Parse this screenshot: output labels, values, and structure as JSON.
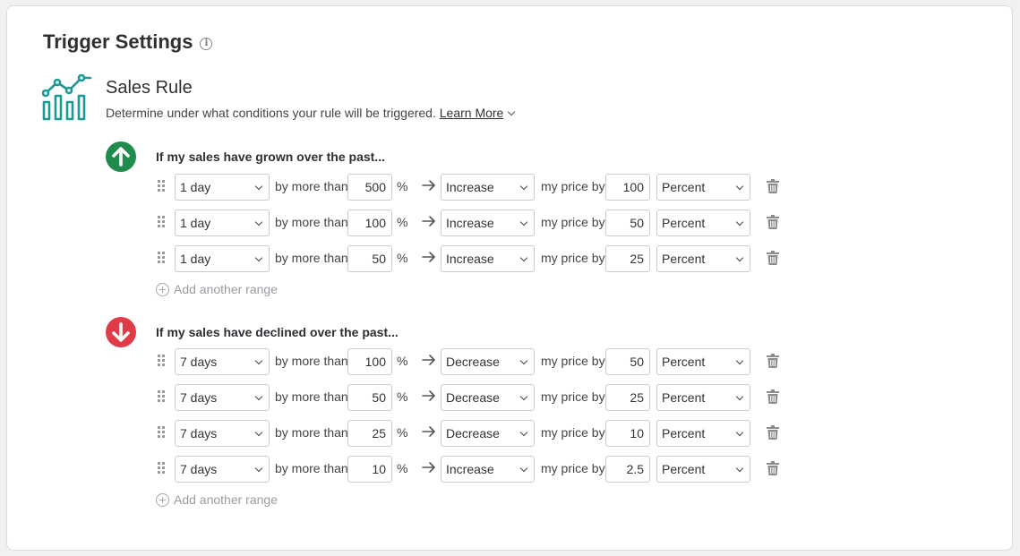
{
  "header": {
    "title": "Trigger Settings"
  },
  "rule": {
    "title": "Sales Rule",
    "description": "Determine under what conditions your rule will be triggered.",
    "learn_more": "Learn More",
    "icon": "chart-icon",
    "accent_color": "#1a9a94"
  },
  "grown": {
    "heading": "If my sales have grown over the past...",
    "icon": "arrow-up-icon",
    "color": "#1f8b4c",
    "add_label": "Add another range",
    "rows": [
      {
        "period": "1 day",
        "by_more_than": "by more than",
        "threshold": "500",
        "pct": "%",
        "action": "Increase",
        "my_price_by": "my price by",
        "amount": "100",
        "unit": "Percent"
      },
      {
        "period": "1 day",
        "by_more_than": "by more than",
        "threshold": "100",
        "pct": "%",
        "action": "Increase",
        "my_price_by": "my price by",
        "amount": "50",
        "unit": "Percent"
      },
      {
        "period": "1 day",
        "by_more_than": "by more than",
        "threshold": "50",
        "pct": "%",
        "action": "Increase",
        "my_price_by": "my price by",
        "amount": "25",
        "unit": "Percent"
      }
    ]
  },
  "declined": {
    "heading": "If my sales have declined over the past...",
    "icon": "arrow-down-icon",
    "color": "#e03b48",
    "add_label": "Add another range",
    "rows": [
      {
        "period": "7 days",
        "by_more_than": "by more than",
        "threshold": "100",
        "pct": "%",
        "action": "Decrease",
        "my_price_by": "my price by",
        "amount": "50",
        "unit": "Percent"
      },
      {
        "period": "7 days",
        "by_more_than": "by more than",
        "threshold": "50",
        "pct": "%",
        "action": "Decrease",
        "my_price_by": "my price by",
        "amount": "25",
        "unit": "Percent"
      },
      {
        "period": "7 days",
        "by_more_than": "by more than",
        "threshold": "25",
        "pct": "%",
        "action": "Decrease",
        "my_price_by": "my price by",
        "amount": "10",
        "unit": "Percent"
      },
      {
        "period": "7 days",
        "by_more_than": "by more than",
        "threshold": "10",
        "pct": "%",
        "action": "Increase",
        "my_price_by": "my price by",
        "amount": "2.5",
        "unit": "Percent"
      }
    ]
  }
}
